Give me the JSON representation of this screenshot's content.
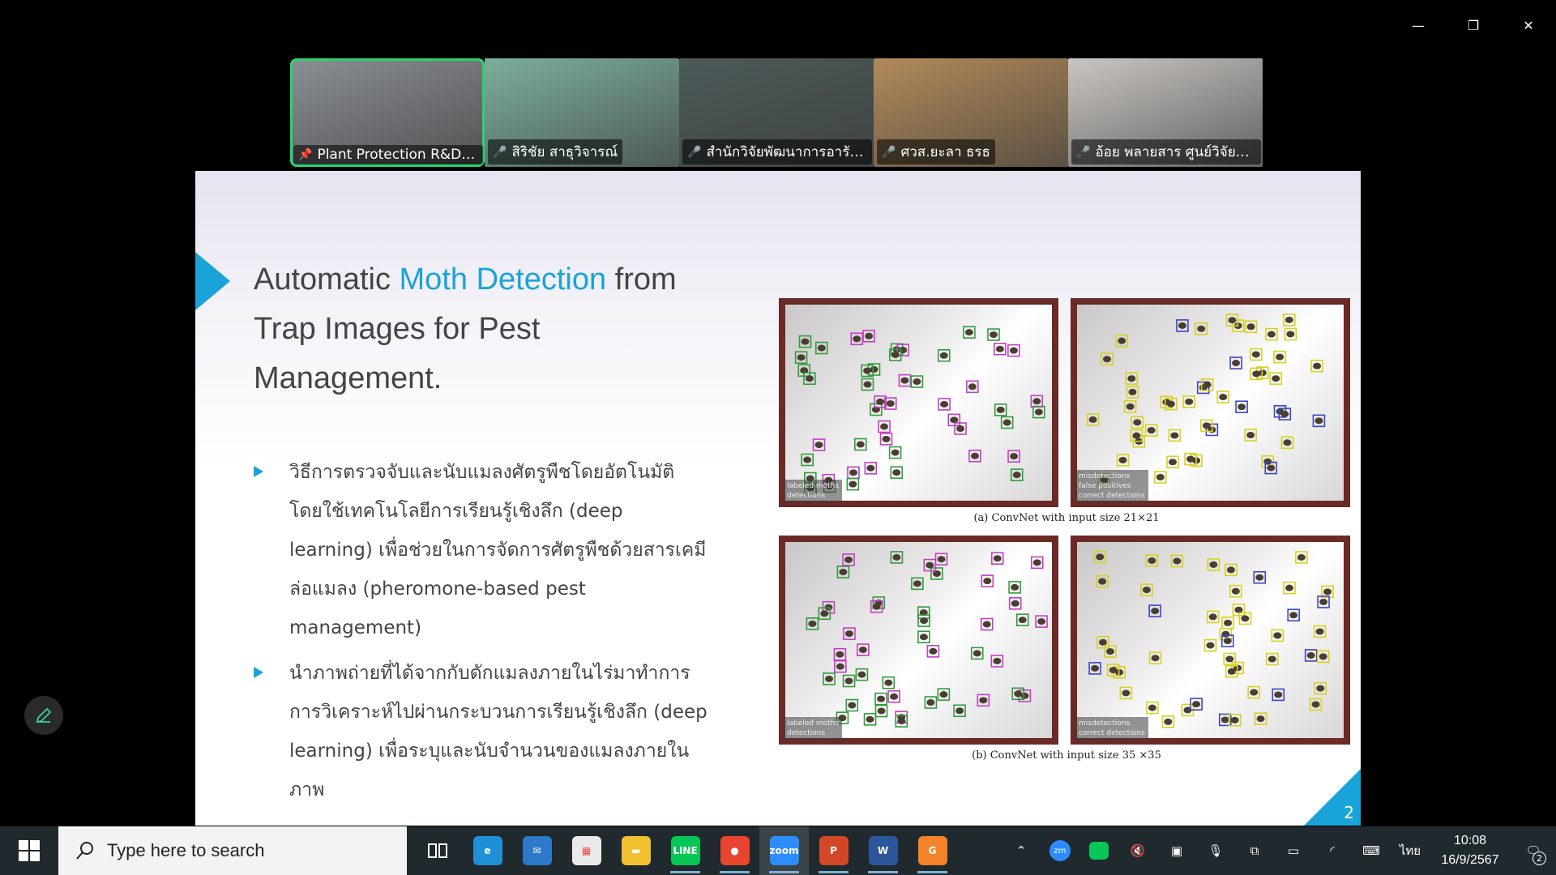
{
  "window_controls": {
    "minimize": "—",
    "restore": "❐",
    "close": "✕"
  },
  "participants": [
    {
      "name": "Plant Protection R&D ...",
      "icon": "pin-icon",
      "active": true,
      "bg": "#8b8f93"
    },
    {
      "name": "สิริชัย สาธุวิจารณ์",
      "icon": "mic-muted-icon",
      "active": false,
      "bg": "#7cae9a"
    },
    {
      "name": "สำนักวิจัยพัฒนาการอารัก...",
      "icon": "mic-muted-icon",
      "active": false,
      "bg": "#4c5a58"
    },
    {
      "name": "ศวส.ยะลา ธรธ",
      "icon": "mic-muted-icon",
      "active": false,
      "bg": "#b18a5a"
    },
    {
      "name": "อ้อย พลายสาร ศูนย์วิจัยแล...",
      "icon": "mic-muted-icon",
      "active": false,
      "bg": "#c9c6c2"
    }
  ],
  "slide": {
    "title_pre": "Automatic ",
    "title_hl": "Moth Detection",
    "title_post": " from Trap Images for Pest Management.",
    "bullets": [
      "วิธีการตรวจจับและนับแมลงศัตรูพืชโดยอัตโนมัติ โดยใช้เทคโนโลยีการเรียนรู้เชิงลึก (deep learning) เพื่อช่วยในการจัดการศัตรูพืชด้วยสารเคมีล่อแมลง (pheromone-based pest management)",
      "นำภาพถ่ายที่ได้จากกับดักแมลงภายในไร่มาทำการการวิเคราะห์ไปผ่านกระบวนการเรียนรู้เชิงลึก (deep learning) เพื่อระบุและนับจำนวนของแมลงภายในภาพ"
    ],
    "legend_a1": [
      "labeled moths",
      "detections"
    ],
    "legend_a2": [
      "misdetections",
      "false positives",
      "correct detections"
    ],
    "legend_b1": [
      "labeled moths",
      "detections"
    ],
    "legend_b2": [
      "misdetections",
      "correct detections"
    ],
    "caption_a": "(a) ConvNet with input size 21×21",
    "caption_b": "(b) ConvNet with input size 35 ×35",
    "page_number": "2"
  },
  "taskbar": {
    "search_placeholder": "Type here to search",
    "apps": [
      {
        "name": "task-view",
        "label": "",
        "color": "transparent"
      },
      {
        "name": "edge",
        "label": "e",
        "color": "#1f8fd8"
      },
      {
        "name": "mail",
        "label": "✉",
        "color": "#2b79c8"
      },
      {
        "name": "store",
        "label": "▦",
        "color": "#e9e9e9"
      },
      {
        "name": "file-explorer",
        "label": "▬",
        "color": "#f2c130"
      },
      {
        "name": "line",
        "label": "LINE",
        "color": "#06c755"
      },
      {
        "name": "chrome",
        "label": "●",
        "color": "#e7452f"
      },
      {
        "name": "zoom",
        "label": "zoom",
        "color": "#2d8cff"
      },
      {
        "name": "powerpoint",
        "label": "P",
        "color": "#d24726"
      },
      {
        "name": "word",
        "label": "W",
        "color": "#2b579a"
      },
      {
        "name": "pdf",
        "label": "G",
        "color": "#f5832a"
      }
    ],
    "language": "ไทย",
    "time": "10:08",
    "date": "16/9/2567",
    "notification_count": "2"
  },
  "colors": {
    "accent": "#1aa3d8",
    "active_speaker": "#2ad36d"
  }
}
